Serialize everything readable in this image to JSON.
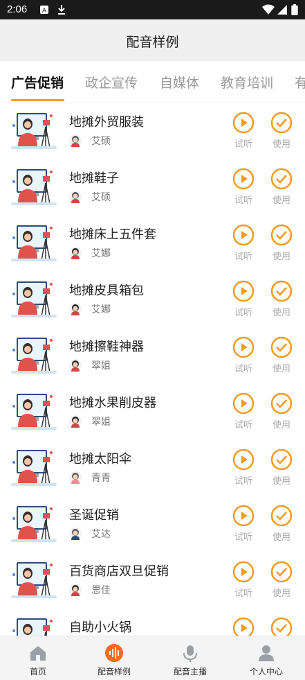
{
  "status_bar": {
    "time": "2:06"
  },
  "header": {
    "title": "配音样例"
  },
  "tabs": [
    {
      "label": "广告促销",
      "active": true
    },
    {
      "label": "政企宣传",
      "active": false
    },
    {
      "label": "自媒体",
      "active": false
    },
    {
      "label": "教育培训",
      "active": false
    },
    {
      "label": "有",
      "active": false
    }
  ],
  "items": [
    {
      "title": "地摊外贸服装",
      "voice": "艾硕",
      "avatar": "male-avatar-icon",
      "listen": "试听",
      "use": "使用"
    },
    {
      "title": "地摊鞋子",
      "voice": "艾硕",
      "avatar": "male-avatar-icon",
      "listen": "试听",
      "use": "使用"
    },
    {
      "title": "地摊床上五件套",
      "voice": "艾娜",
      "avatar": "female-avatar-icon",
      "listen": "试听",
      "use": "使用"
    },
    {
      "title": "地摊皮具箱包",
      "voice": "艾娜",
      "avatar": "female-avatar-icon",
      "listen": "试听",
      "use": "使用"
    },
    {
      "title": "地摊擦鞋神器",
      "voice": "翠姐",
      "avatar": "female-avatar-icon",
      "listen": "试听",
      "use": "使用"
    },
    {
      "title": "地摊水果削皮器",
      "voice": "翠姐",
      "avatar": "female-avatar-icon",
      "listen": "试听",
      "use": "使用"
    },
    {
      "title": "地摊太阳伞",
      "voice": "青青",
      "avatar": "girl-avatar-icon",
      "listen": "试听",
      "use": "使用"
    },
    {
      "title": "圣诞促销",
      "voice": "艾达",
      "avatar": "boy-avatar-icon",
      "listen": "试听",
      "use": "使用"
    },
    {
      "title": "百货商店双旦促销",
      "voice": "思佳",
      "avatar": "female-avatar-icon",
      "listen": "试听",
      "use": "使用"
    },
    {
      "title": "自助小火锅",
      "voice": "",
      "avatar": "",
      "listen": "试听",
      "use": "使用"
    }
  ],
  "bottom_nav": [
    {
      "label": "首页",
      "icon": "home-icon"
    },
    {
      "label": "配音样例",
      "icon": "sound-wave-icon",
      "active": true
    },
    {
      "label": "配音主播",
      "icon": "microphone-icon"
    },
    {
      "label": "个人中心",
      "icon": "user-icon"
    }
  ],
  "colors": {
    "accent": "#f39a1f",
    "header_bg": "#efefef",
    "status_bar": "#1a1a1a"
  }
}
